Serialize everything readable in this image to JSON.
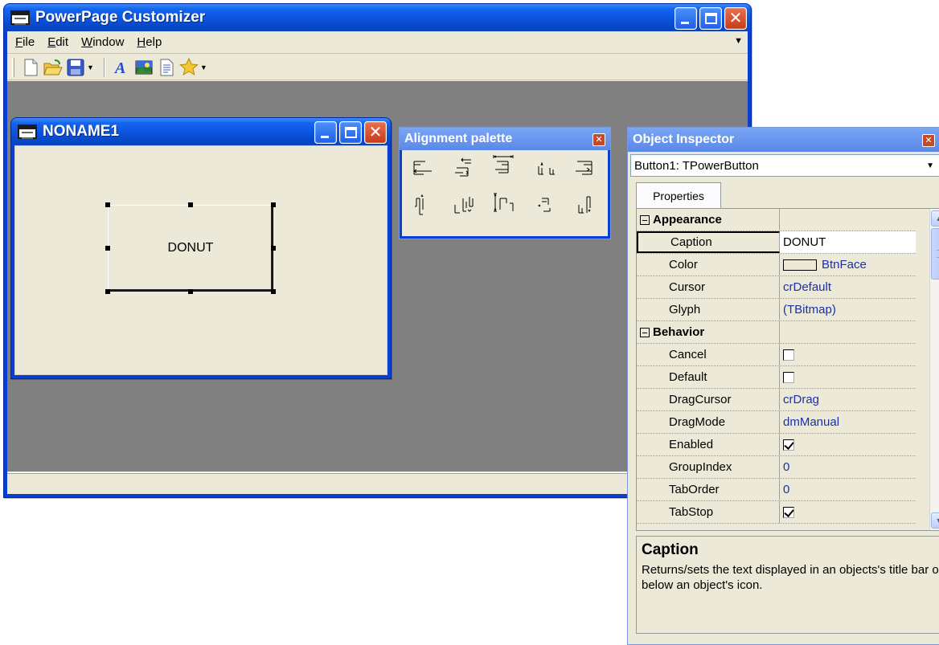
{
  "main_window": {
    "title": "PowerPage Customizer",
    "menu": [
      {
        "label": "File",
        "accel": "F",
        "rest": "ile"
      },
      {
        "label": "Edit",
        "accel": "E",
        "rest": "dit"
      },
      {
        "label": "Window",
        "accel": "W",
        "rest": "indow"
      },
      {
        "label": "Help",
        "accel": "H",
        "rest": "elp"
      }
    ],
    "toolbar_icons": [
      "new-document-icon",
      "open-folder-icon",
      "save-disk-icon",
      "font-icon",
      "image-icon",
      "text-file-icon",
      "star-icon"
    ]
  },
  "form_window": {
    "title": "NONAME1",
    "selected_component_caption": "DONUT"
  },
  "alignment_palette": {
    "title": "Alignment palette",
    "buttons": [
      "align-left-edges-icon",
      "align-horizontal-centers-icon",
      "center-horizontally-icon",
      "space-equally-horizontally-icon",
      "align-right-edges-icon",
      "align-top-edges-icon",
      "align-vertical-centers-icon",
      "center-vertically-icon",
      "space-equally-vertically-icon",
      "align-bottom-edges-icon"
    ]
  },
  "object_inspector": {
    "title": "Object Inspector",
    "selected_object": "Button1: TPowerButton",
    "tab": "Properties",
    "rows": [
      {
        "type": "category",
        "name": "Appearance"
      },
      {
        "type": "prop",
        "name": "Caption",
        "value": "DONUT",
        "selected": true
      },
      {
        "type": "prop",
        "name": "Color",
        "value": "BtnFace",
        "swatch": "#ece9d8"
      },
      {
        "type": "prop",
        "name": "Cursor",
        "value": "crDefault"
      },
      {
        "type": "prop",
        "name": "Glyph",
        "value": "(TBitmap)"
      },
      {
        "type": "category",
        "name": "Behavior"
      },
      {
        "type": "check",
        "name": "Cancel",
        "checked": false
      },
      {
        "type": "check",
        "name": "Default",
        "checked": false
      },
      {
        "type": "prop",
        "name": "DragCursor",
        "value": "crDrag"
      },
      {
        "type": "prop",
        "name": "DragMode",
        "value": "dmManual"
      },
      {
        "type": "check",
        "name": "Enabled",
        "checked": true
      },
      {
        "type": "prop",
        "name": "GroupIndex",
        "value": "0"
      },
      {
        "type": "prop",
        "name": "TabOrder",
        "value": "0"
      },
      {
        "type": "check",
        "name": "TabStop",
        "checked": true
      }
    ],
    "help_title": "Caption",
    "help_text": "Returns/sets the text displayed in an objects's title bar or below an object's icon."
  },
  "colors": {
    "xp_titlebar_blue": "#0b53dc",
    "face": "#ece9d8",
    "mdi_background": "#808080",
    "value_text": "#1a2fa8"
  }
}
